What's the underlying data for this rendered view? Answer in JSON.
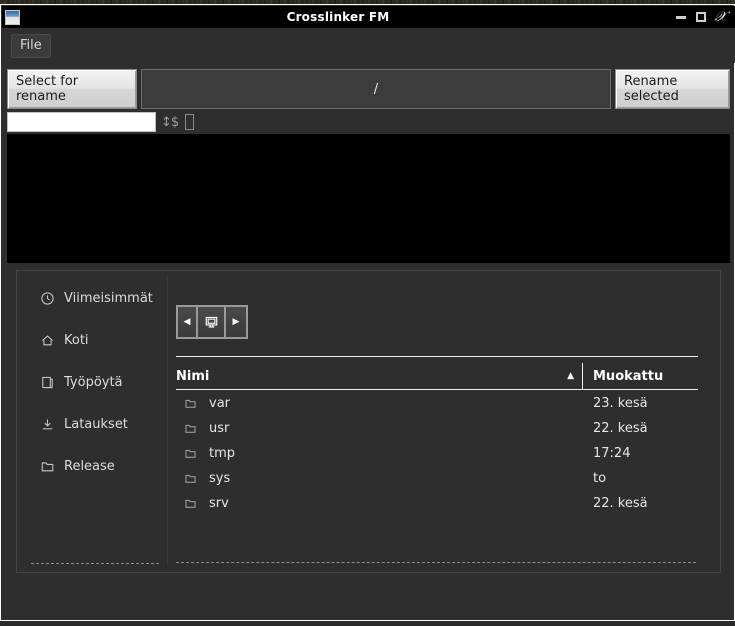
{
  "window": {
    "title": "Crosslinker FM",
    "icon": "window-icon",
    "controls": {
      "minimize": "minimize-icon",
      "maximize": "maximize-icon",
      "close": "close-icon"
    }
  },
  "menubar": {
    "items": [
      {
        "label": "File",
        "name": "menu-file"
      }
    ]
  },
  "toolbar": {
    "select_for_rename_label": "Select for rename",
    "path_value": "/",
    "rename_selected_label": "Rename selected"
  },
  "rename_row": {
    "input_value": "",
    "input_placeholder": "",
    "spin_icon": "spin-adjust-icon",
    "checkbox_icon": "empty-checkbox-icon"
  },
  "preview": {
    "background": "#000000"
  },
  "chooser": {
    "sidebar": {
      "items": [
        {
          "label": "Viimeisimmät",
          "icon": "clock-icon",
          "name": "sidebar-item-recent"
        },
        {
          "label": "Koti",
          "icon": "home-icon",
          "name": "sidebar-item-home"
        },
        {
          "label": "Työpöytä",
          "icon": "desktop-icon",
          "name": "sidebar-item-desktop"
        },
        {
          "label": "Lataukset",
          "icon": "download-icon",
          "name": "sidebar-item-downloads"
        },
        {
          "label": "Release",
          "icon": "folder-icon",
          "name": "sidebar-item-release"
        }
      ]
    },
    "nav": {
      "back_icon": "caret-left-icon",
      "computer_icon": "computer-icon",
      "forward_icon": "caret-right-icon"
    },
    "table": {
      "columns": [
        {
          "label": "Nimi",
          "sort": "ascending",
          "sort_arrow": "▲"
        },
        {
          "label": "Muokattu"
        }
      ],
      "rows": [
        {
          "icon": "folder-icon",
          "name": "var",
          "modified": "23. kesä"
        },
        {
          "icon": "folder-icon",
          "name": "usr",
          "modified": "22. kesä"
        },
        {
          "icon": "folder-icon",
          "name": "tmp",
          "modified": "17:24"
        },
        {
          "icon": "folder-icon",
          "name": "sys",
          "modified": "to"
        },
        {
          "icon": "folder-icon",
          "name": "srv",
          "modified": "22. kesä"
        }
      ]
    }
  },
  "colors": {
    "window_background": "#2e2e2e",
    "titlebar_background": "#000000",
    "preview_background": "#000000",
    "text": "#e6e6e6",
    "button_face": "#e3e3e3"
  }
}
